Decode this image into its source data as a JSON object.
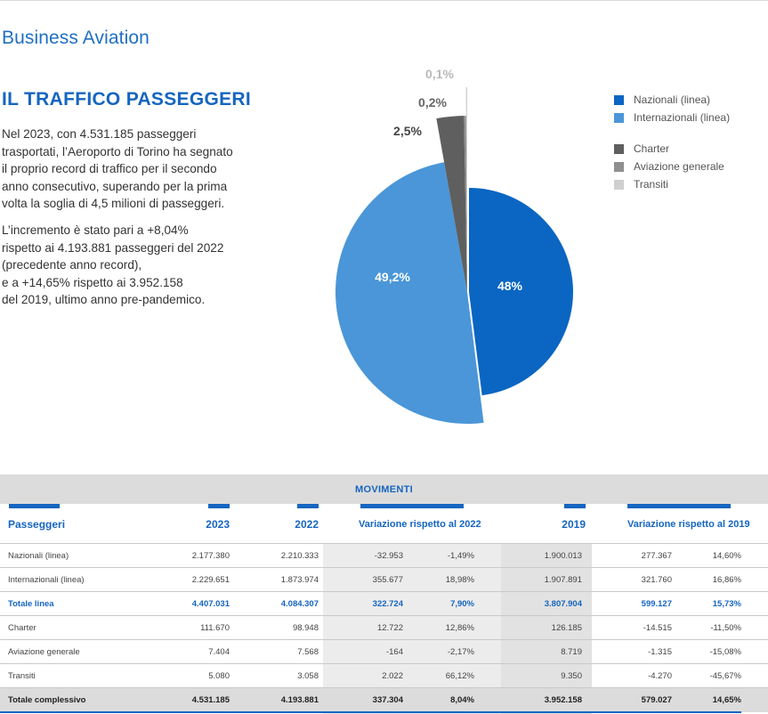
{
  "section_title": "Business Aviation",
  "heading": "IL TRAFFICO PASSEGGERI",
  "paragraph1": [
    "Nel 2023, con 4.531.185 passeggeri",
    "trasportati, l’Aeroporto di Torino ha segnato",
    "il proprio record di traffico per il secondo",
    "anno consecutivo, superando per la prima",
    "volta la soglia di 4,5 milioni di passeggeri."
  ],
  "paragraph2": [
    "L’incremento è stato pari a +8,04%",
    "rispetto ai 4.193.881 passeggeri del 2022",
    "(precedente anno record),",
    "e a +14,65% rispetto ai 3.952.158",
    "del 2019, ultimo anno pre-pandemico."
  ],
  "chart_data": {
    "type": "pie",
    "slices": [
      {
        "name": "Nazionali (linea)",
        "value": 48.0,
        "label": "48%",
        "color": "#0a66c2"
      },
      {
        "name": "Internazionali (linea)",
        "value": 49.2,
        "label": "49,2%",
        "color": "#4a96d8"
      },
      {
        "name": "Charter",
        "value": 2.5,
        "label": "2,5%",
        "color": "#5f5f5f"
      },
      {
        "name": "Aviazione generale",
        "value": 0.2,
        "label": "0,2%",
        "color": "#8f8f8f"
      },
      {
        "name": "Transiti",
        "value": 0.1,
        "label": "0,1%",
        "color": "#cfcfcf"
      }
    ],
    "legend_position": "right"
  },
  "table": {
    "band_title": "MOVIMENTI",
    "headers": [
      "Passeggeri",
      "2023",
      "2022",
      "Variazione rispetto al 2022",
      "2019",
      "Variazione rispetto al 2019"
    ],
    "rows": [
      [
        "Nazionali (linea)",
        "2.177.380",
        "2.210.333",
        "-32.953",
        "-1,49%",
        "1.900.013",
        "277.367",
        "14,60%"
      ],
      [
        "Internazionali (linea)",
        "2.229.651",
        "1.873.974",
        "355.677",
        "18,98%",
        "1.907.891",
        "321.760",
        "16,86%"
      ],
      [
        "Totale linea",
        "4.407.031",
        "4.084.307",
        "322.724",
        "7,90%",
        "3.807.904",
        "599.127",
        "15,73%"
      ],
      [
        "Charter",
        "111.670",
        "98.948",
        "12.722",
        "12,86%",
        "126.185",
        "-14.515",
        "-11,50%"
      ],
      [
        "Aviazione generale",
        "7.404",
        "7.568",
        "-164",
        "-2,17%",
        "8.719",
        "-1.315",
        "-15,08%"
      ],
      [
        "Transiti",
        "5.080",
        "3.058",
        "2.022",
        "66,12%",
        "9.350",
        "-4.270",
        "-45,67%"
      ],
      [
        "Totale complessivo",
        "4.531.185",
        "4.193.881",
        "337.304",
        "8,04%",
        "3.952.158",
        "579.027",
        "14,65%"
      ]
    ]
  }
}
